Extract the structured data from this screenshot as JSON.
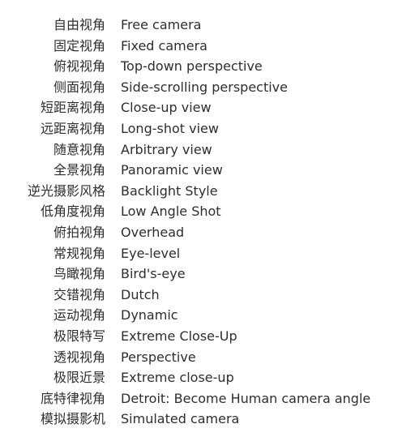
{
  "items": [
    {
      "zh": "自由视角",
      "en": "Free camera"
    },
    {
      "zh": "固定视角",
      "en": "Fixed camera"
    },
    {
      "zh": "俯视视角",
      "en": "Top-down perspective"
    },
    {
      "zh": "侧面视角",
      "en": "Side-scrolling perspective"
    },
    {
      "zh": "短距离视角",
      "en": "Close-up view"
    },
    {
      "zh": "远距离视角",
      "en": "Long-shot view"
    },
    {
      "zh": "随意视角",
      "en": "Arbitrary view"
    },
    {
      "zh": "全景视角",
      "en": "Panoramic view"
    },
    {
      "zh": "逆光摄影风格",
      "en": "Backlight Style"
    },
    {
      "zh": "低角度视角",
      "en": "Low Angle Shot"
    },
    {
      "zh": "俯拍视角",
      "en": "Overhead"
    },
    {
      "zh": "常规视角",
      "en": "Eye-level"
    },
    {
      "zh": "鸟瞰视角",
      "en": "Bird's-eye"
    },
    {
      "zh": "交错视角",
      "en": "Dutch"
    },
    {
      "zh": "运动视角",
      "en": "Dynamic"
    },
    {
      "zh": "极限特写",
      "en": "Extreme Close-Up"
    },
    {
      "zh": "透视视角",
      "en": "Perspective"
    },
    {
      "zh": "极限近景",
      "en": "Extreme close-up"
    },
    {
      "zh": "底特律视角",
      "en": "Detroit: Become Human camera angle"
    },
    {
      "zh": "模拟摄影机",
      "en": "Simulated camera"
    }
  ]
}
